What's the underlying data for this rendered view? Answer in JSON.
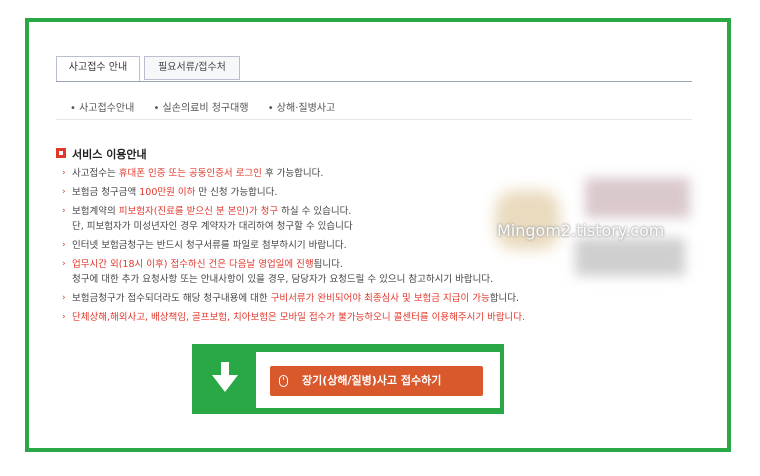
{
  "tabs": [
    "사고접수 안내",
    "필요서류/접수처"
  ],
  "subnav": [
    "• 사고접수안내",
    "• 실손의료비 청구대행",
    "• 상해·질병사고"
  ],
  "service_title": "서비스 이용안내",
  "items": [
    {
      "parts": [
        {
          "t": "사고접수는 "
        },
        {
          "t": "휴대폰 인증 또는 공동인증서 로그인",
          "red": true
        },
        {
          "t": " 후 가능합니다."
        }
      ]
    },
    {
      "parts": [
        {
          "t": "보험금 청구금액 "
        },
        {
          "t": "100만원 이하",
          "red": true
        },
        {
          "t": " 만 신청 가능합니다."
        }
      ]
    },
    {
      "parts": [
        {
          "t": "보험계약의 "
        },
        {
          "t": "피보험자(진료를 받으신 분 본인)가 청구",
          "red": true
        },
        {
          "t": " 하실 수 있습니다."
        }
      ],
      "line2": "단, 피보험자가 미성년자인 경우 계약자가 대리하여 청구할 수 있습니다"
    },
    {
      "parts": [
        {
          "t": "인터넷 보험금청구는 반드시 청구서류를 파일로 첨부하시기 바랍니다."
        }
      ]
    },
    {
      "parts": [
        {
          "t": "업무시간 외(18시 이후) 접수하신 건은 다음날 영업일에 진행",
          "red": true
        },
        {
          "t": "됩니다."
        }
      ],
      "line2": "청구에 대한 추가 요청사항 또는 안내사항이 있을 경우, 담당자가 요청드릴 수 있으니 참고하시기 바랍니다."
    },
    {
      "parts": [
        {
          "t": "보험금청구가 접수되더라도 해당 청구내용에 대한 "
        },
        {
          "t": "구비서류가 완비되어야 최종심사 및 보험금 지급이 가능",
          "red": true
        },
        {
          "t": "합니다."
        }
      ]
    },
    {
      "parts": [
        {
          "t": "단체상해,해외사고, 배상책임, 골프보험, 치아보험은 모바일 접수가 불가능하오니 콜센터를 이용해주시기 바랍니다.",
          "red": true
        }
      ]
    }
  ],
  "watermark": "Mingom2.tistory.com",
  "cta_label": "장기(상해/질병)사고 접수하기",
  "colors": {
    "green": "#2aa846",
    "red": "#e2382c",
    "button": "#d9582c"
  }
}
